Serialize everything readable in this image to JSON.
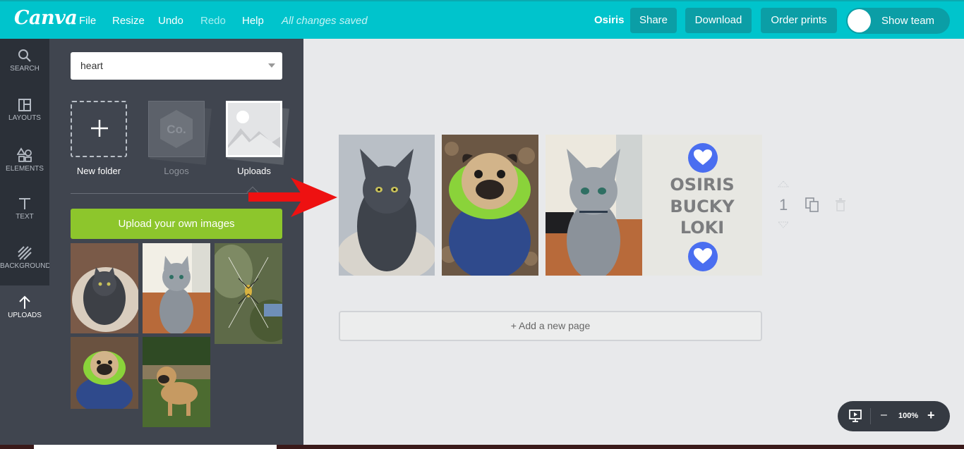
{
  "topbar": {
    "logo": "Canva",
    "menu": [
      "File",
      "Resize",
      "Undo",
      "Redo",
      "Help"
    ],
    "status": "All changes saved",
    "team": "Osiris",
    "share": "Share",
    "download": "Download",
    "order_prints": "Order prints",
    "show_team": "Show team"
  },
  "rail": [
    {
      "label": "SEARCH",
      "icon": "search-icon"
    },
    {
      "label": "LAYOUTS",
      "icon": "layouts-icon"
    },
    {
      "label": "ELEMENTS",
      "icon": "elements-icon"
    },
    {
      "label": "TEXT",
      "icon": "text-icon"
    },
    {
      "label": "BACKGROUND",
      "icon": "background-icon"
    },
    {
      "label": "UPLOADS",
      "icon": "upload-arrow-icon"
    }
  ],
  "panel": {
    "folder_select": "heart",
    "folders": [
      "New folder",
      "Logos",
      "Uploads"
    ],
    "logos_placeholder": "Co.",
    "upload_button": "Upload your own images"
  },
  "design": {
    "names": [
      "OSIRIS",
      "BUCKY",
      "LOKI"
    ],
    "page_number": "1",
    "add_page": "+ Add a new page"
  },
  "zoom": {
    "value": "100%",
    "minus": "–",
    "plus": "+"
  },
  "colors": {
    "brand": "#00c4cc",
    "upload_button": "#8dc62c",
    "heart": "#4a6ef0",
    "arrow": "#ee1111"
  }
}
